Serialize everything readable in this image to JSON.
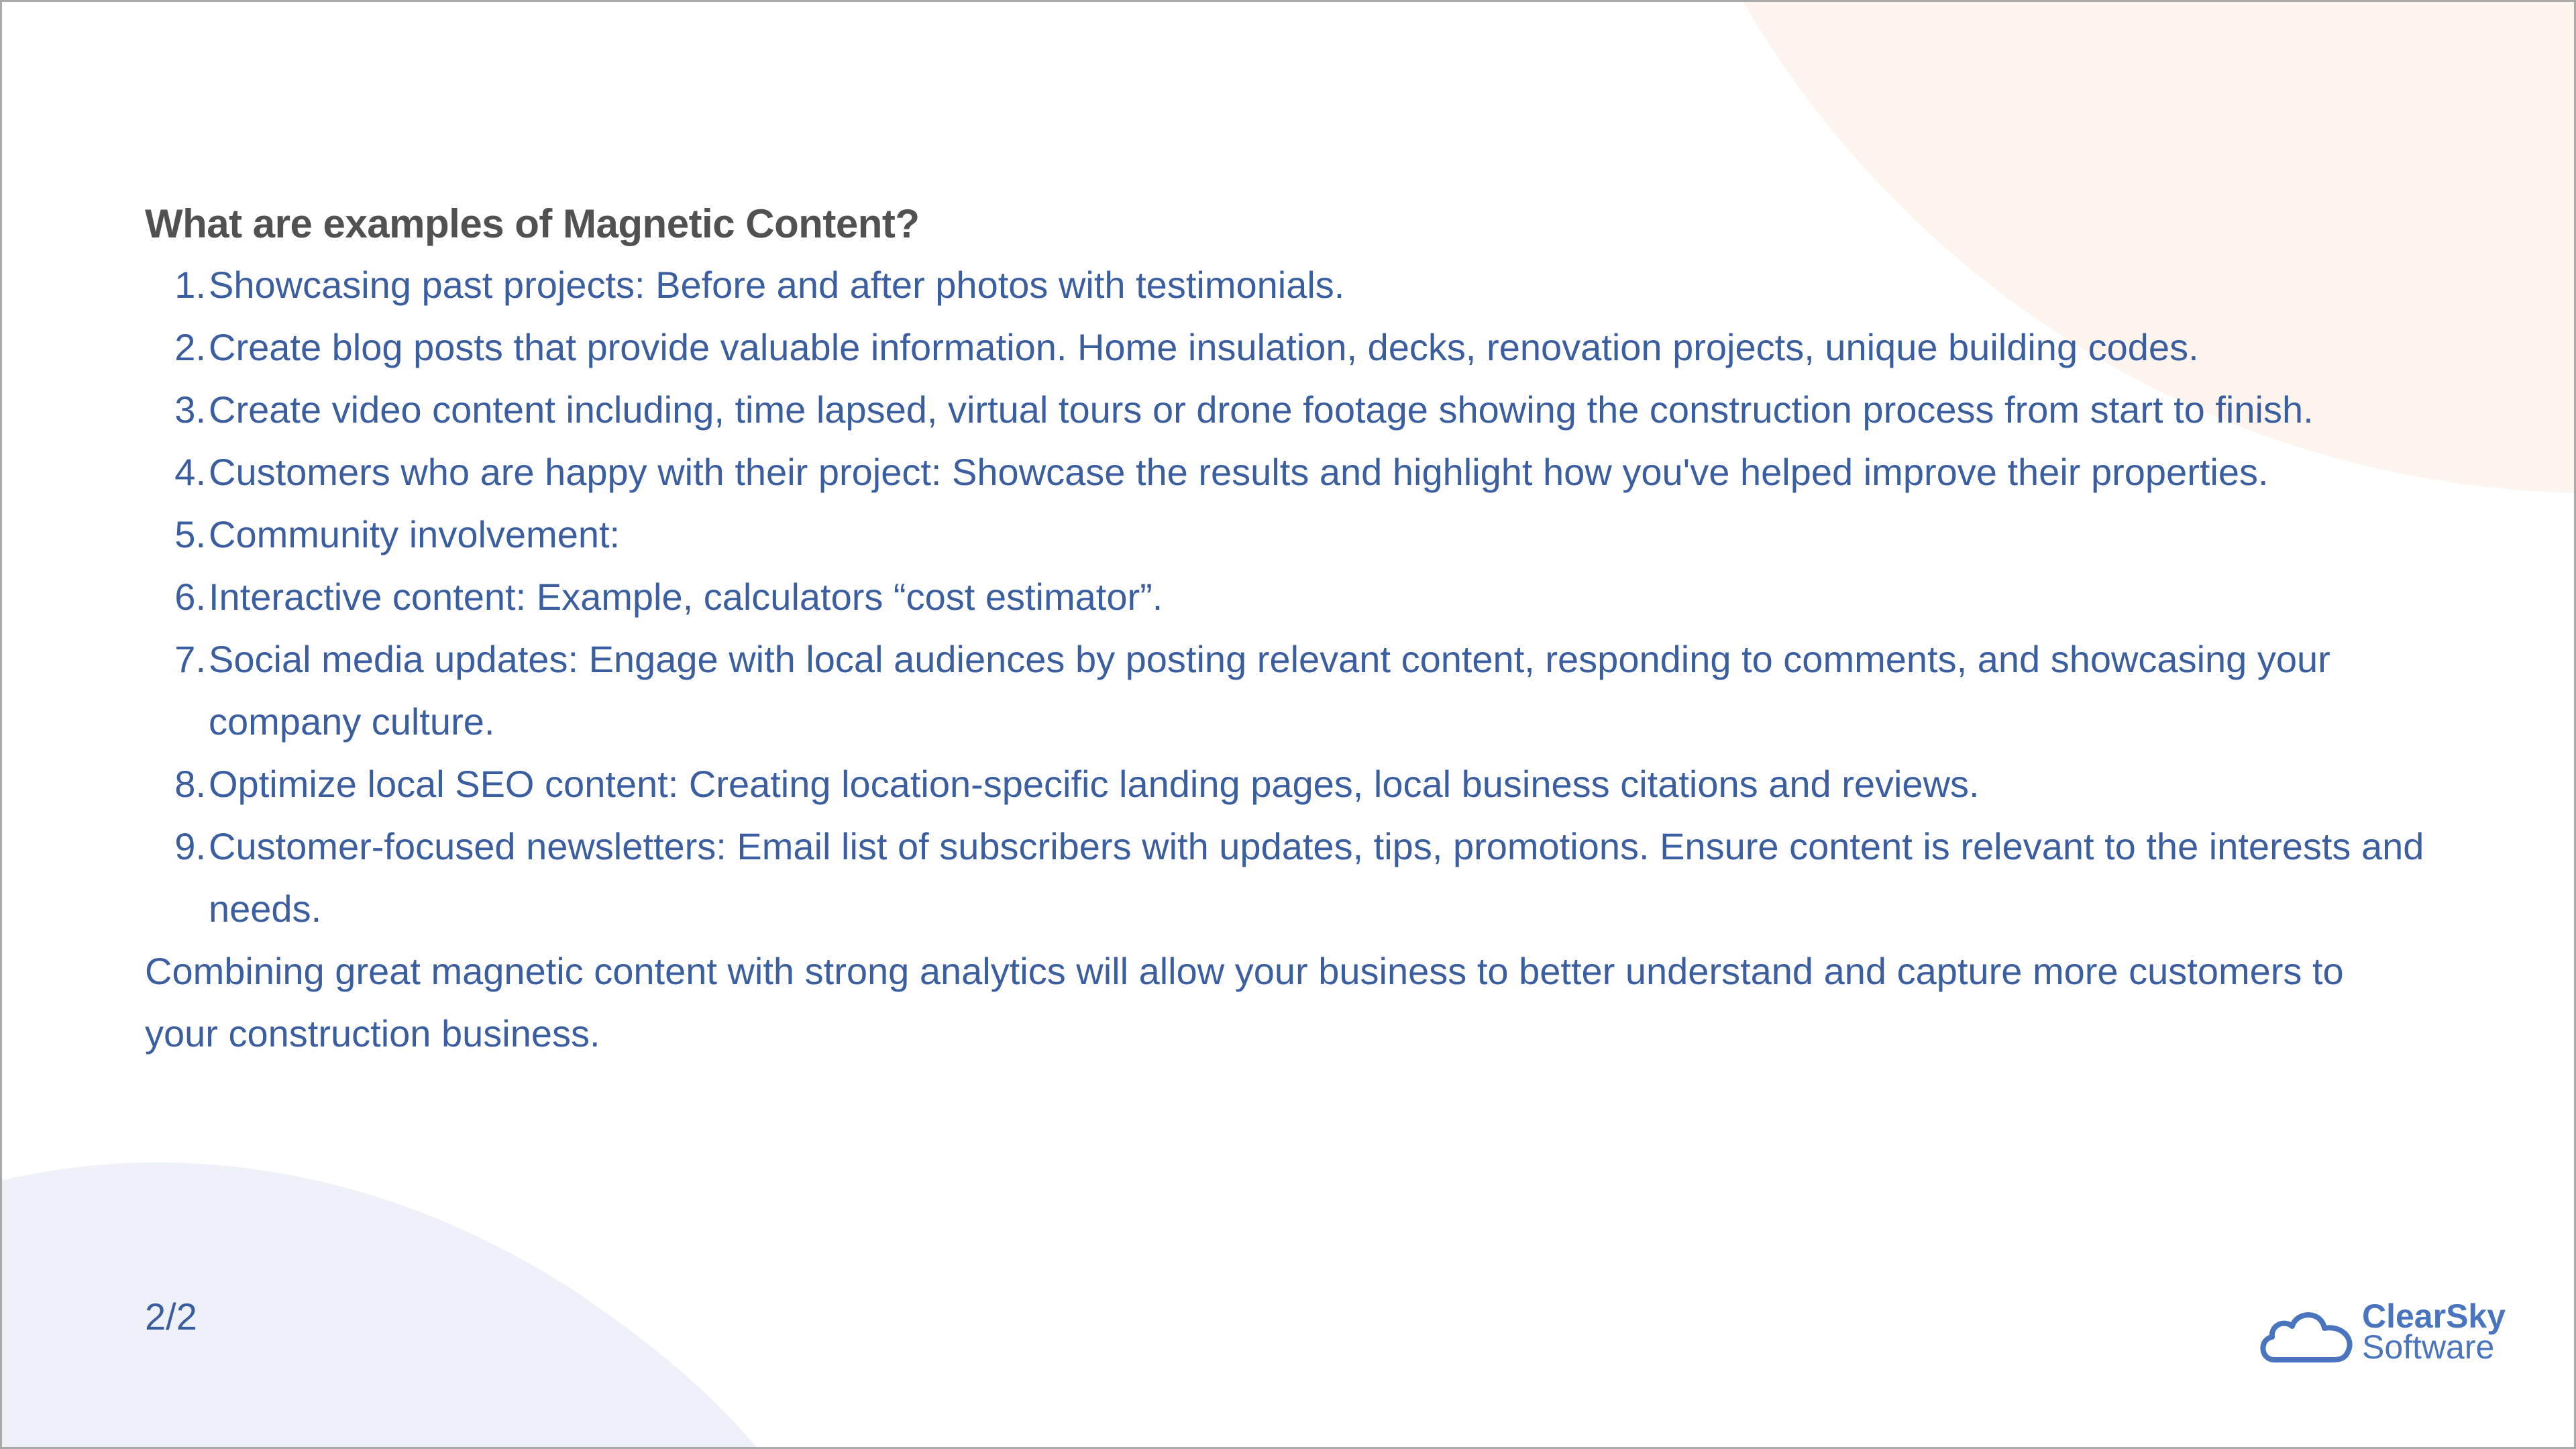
{
  "heading": "What are examples of Magnetic Content?",
  "items": [
    {
      "num": "1.",
      "text": "Showcasing past projects: Before and after photos with testimonials."
    },
    {
      "num": "2.",
      "text": "Create blog posts that provide valuable information. Home insulation, decks, renovation projects, unique building codes."
    },
    {
      "num": "3.",
      "text": "Create video content including, time lapsed, virtual tours or drone footage showing the construction process from start to finish."
    },
    {
      "num": "4.",
      "text": "Customers who are happy with their project: Showcase the results and highlight how you've helped improve their properties."
    },
    {
      "num": "5.",
      "text": "Community involvement:"
    },
    {
      "num": "6.",
      "text": "Interactive content: Example, calculators “cost estimator”."
    },
    {
      "num": "7.",
      "text": "Social media updates: Engage with local audiences by posting relevant content, responding to comments, and showcasing your company culture."
    },
    {
      "num": "8.",
      "text": "Optimize local SEO content: Creating location-specific landing pages, local business citations and reviews."
    },
    {
      "num": "9.",
      "text": "Customer-focused newsletters: Email list of subscribers with updates, tips, promotions. Ensure content is relevant to the interests and needs."
    }
  ],
  "closing": "Combining great magnetic content with strong analytics will allow your business to better understand and capture more customers to your construction business.",
  "page_number": "2/2",
  "logo": {
    "line1": "ClearSky",
    "line2": "Software",
    "icon": "cloud-icon"
  },
  "colors": {
    "text_blue": "#3a5ea0",
    "heading": "#515151",
    "peach": "#fdf3ec",
    "blob_blue": "#eef1f7",
    "logo_blue": "#4a74bd"
  }
}
